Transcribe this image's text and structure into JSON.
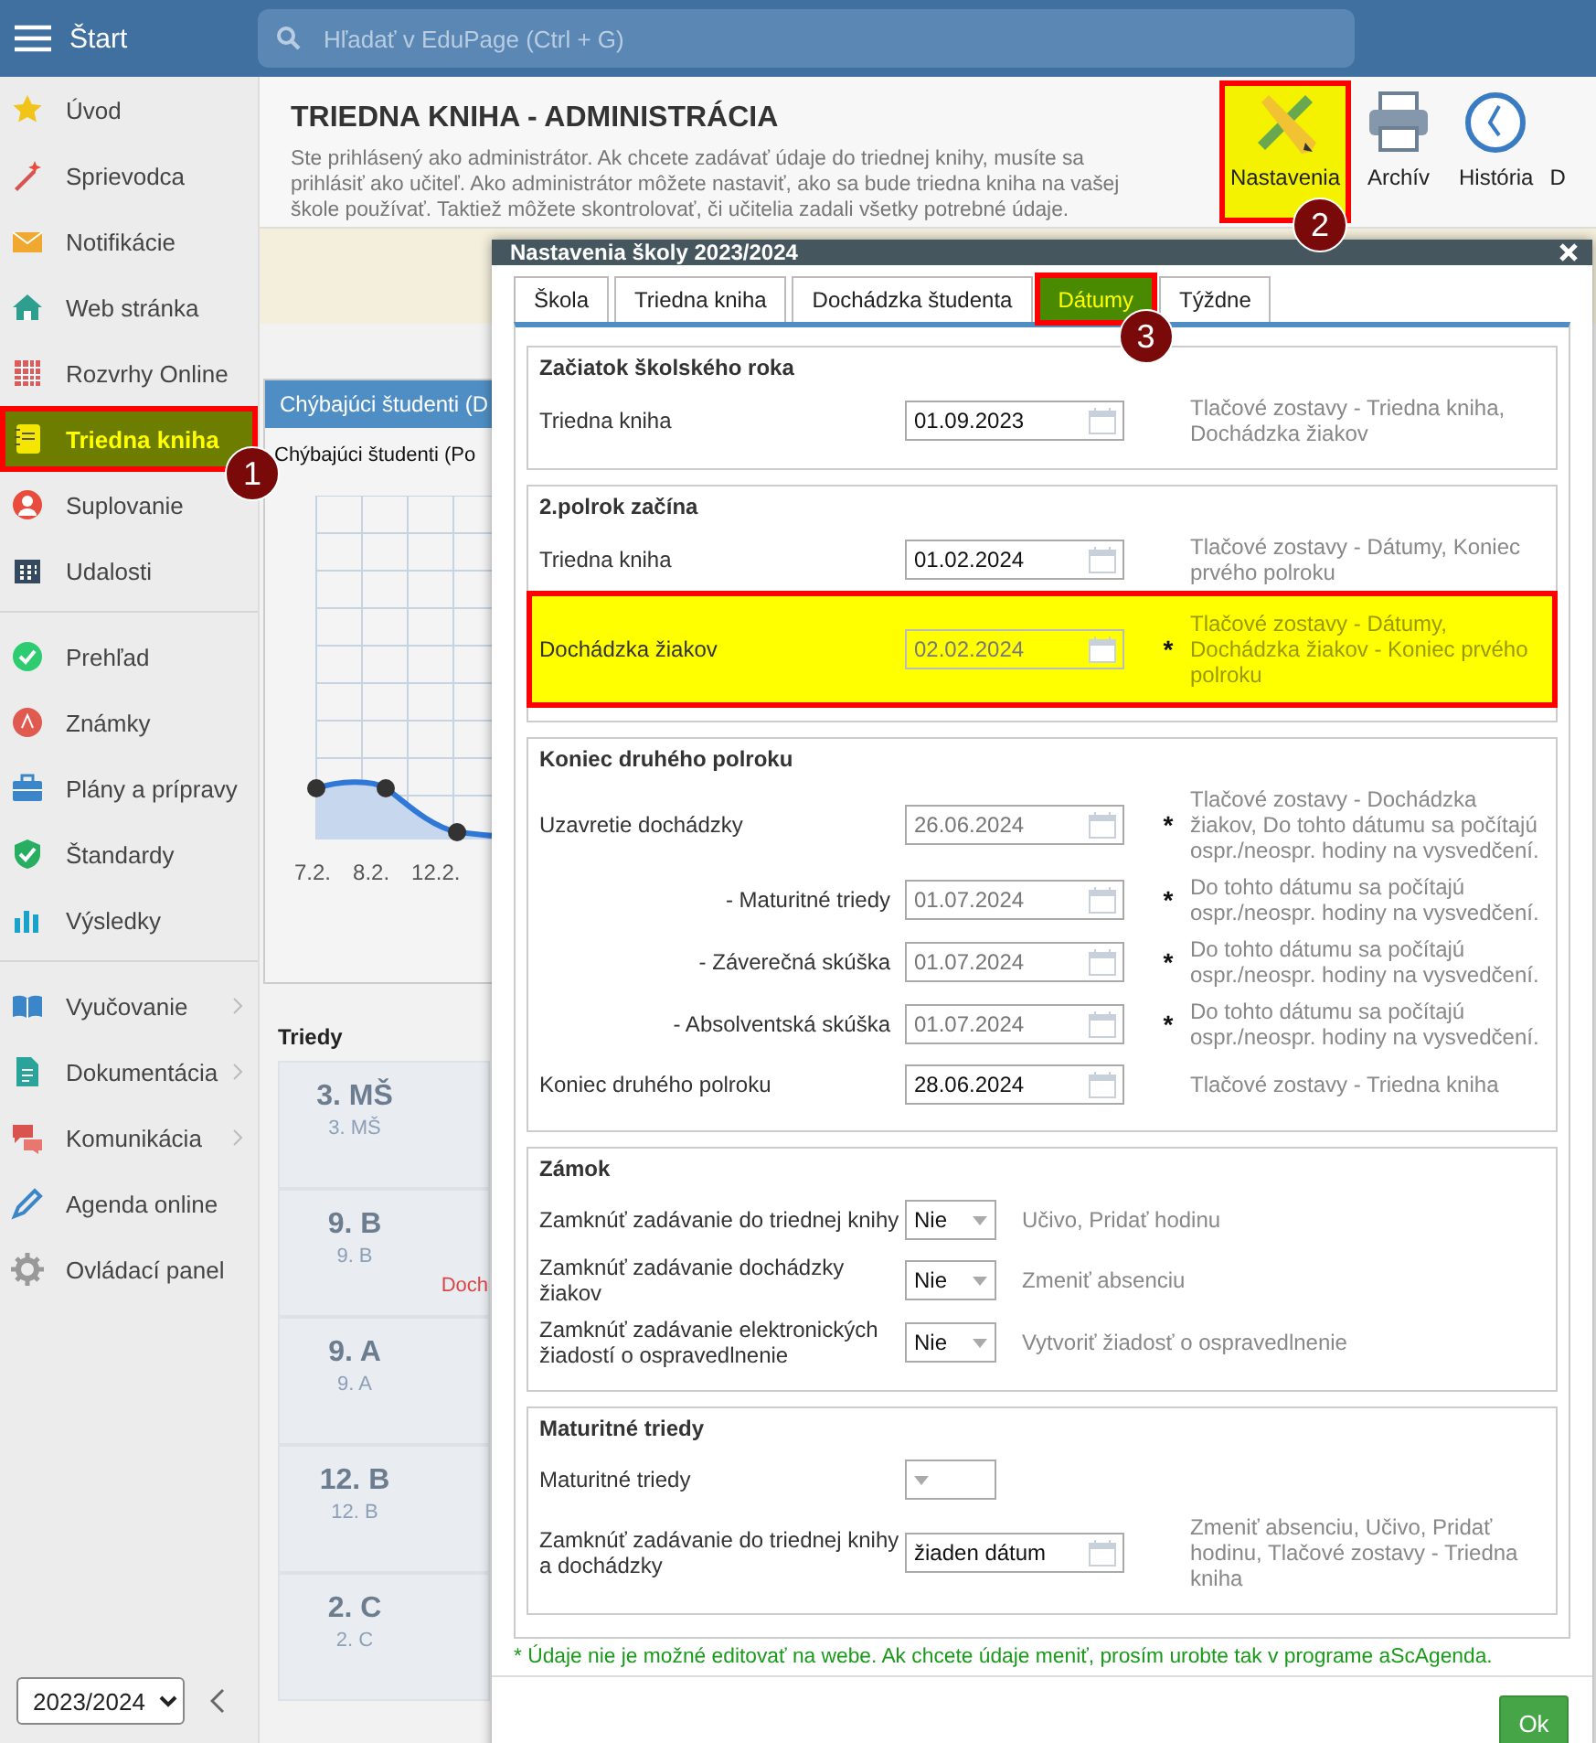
{
  "top_bar": {
    "menu_label": "Štart",
    "search": {
      "placeholder": "Hľadať v EduPage (Ctrl + G)"
    }
  },
  "sidebar": {
    "groups": [
      {
        "items": [
          {
            "label": "Úvod",
            "selected": false
          },
          {
            "label": "Sprievodca",
            "selected": false
          },
          {
            "label": "Notifikácie",
            "selected": false
          },
          {
            "label": "Web stránka",
            "selected": false
          },
          {
            "label": "Rozvrhy Online",
            "selected": false
          },
          {
            "label": "Triedna kniha",
            "selected": true,
            "step": "1"
          },
          {
            "label": "Suplovanie",
            "selected": false
          },
          {
            "label": "Udalosti",
            "selected": false
          }
        ]
      },
      {
        "items": [
          {
            "label": "Prehľad",
            "selected": false
          },
          {
            "label": "Známky",
            "selected": false
          },
          {
            "label": "Plány a prípravy",
            "selected": false
          },
          {
            "label": "Štandardy",
            "selected": false
          },
          {
            "label": "Výsledky",
            "selected": false
          }
        ]
      },
      {
        "items": [
          {
            "label": "Vyučovanie",
            "selected": false,
            "has_submenu": true
          },
          {
            "label": "Dokumentácia",
            "selected": false,
            "has_submenu": true
          },
          {
            "label": "Komunikácia",
            "selected": false,
            "has_submenu": true
          },
          {
            "label": "Agenda online",
            "selected": false,
            "has_submenu": false
          },
          {
            "label": "Ovládací panel",
            "selected": false,
            "has_submenu": false
          }
        ]
      }
    ],
    "year_select": "2023/2024"
  },
  "page_header": {
    "title": "TRIEDNA KNIHA - ADMINISTRÁCIA",
    "description": "Ste prihlásený ako administrátor. Ak chcete zadávať údaje do triednej knihy, musíte sa prihlásiť ako učiteľ. Ako administrátor môžete nastaviť, ako sa bude triedna kniha na vašej škole používať. Taktiež môžete skontrolovať, či učitelia zadali všetky potrebné údaje.",
    "toolbar": [
      {
        "label": "Nastavenia",
        "selected": true,
        "step": "2"
      },
      {
        "label": "Archív",
        "selected": false
      },
      {
        "label": "História",
        "selected": false
      },
      {
        "label": "D",
        "selected": false
      }
    ]
  },
  "absence_card": {
    "title": "Chýbajúci študenti (D",
    "subtitle": "Chýbajúci študenti (Po",
    "x_labels": [
      "7.2.",
      "8.2.",
      "12.2."
    ]
  },
  "classes": {
    "title": "Triedy",
    "items": [
      {
        "name": "3. MŠ",
        "short": "3. MŠ"
      },
      {
        "name": "9. B",
        "short": "9. B",
        "note": "Doch"
      },
      {
        "name": "9. A",
        "short": "9. A"
      },
      {
        "name": "12. B",
        "short": "12. B"
      },
      {
        "name": "2. C",
        "short": "2. C"
      }
    ]
  },
  "dialog": {
    "title": "Nastavenia školy 2023/2024",
    "tabs": [
      {
        "label": "Škola",
        "selected": false
      },
      {
        "label": "Triedna kniha",
        "selected": false
      },
      {
        "label": "Dochádzka študenta",
        "selected": false
      },
      {
        "label": "Dátumy",
        "selected": true,
        "step": "3"
      },
      {
        "label": "Týždne",
        "selected": false
      }
    ],
    "sections": [
      {
        "title": "Začiatok školského roka",
        "rows": [
          {
            "kind": "date",
            "label": "Triedna kniha",
            "value": "01.09.2023",
            "disabled": false,
            "note": "Tlačové zostavy - Triedna kniha, Dochádzka žiakov"
          }
        ]
      },
      {
        "title": "2.polrok začína",
        "rows": [
          {
            "kind": "date",
            "label": "Triedna kniha",
            "value": "01.02.2024",
            "disabled": false,
            "note": "Tlačové zostavy - Dátumy, Koniec prvého polroku"
          },
          {
            "kind": "date",
            "label": "Dochádzka žiakov",
            "value": "02.02.2024",
            "disabled": true,
            "mark": "*",
            "highlighted": true,
            "note": "Tlačové zostavy - Dátumy, Dochádzka žiakov - Koniec prvého polroku"
          }
        ]
      },
      {
        "title": "Koniec druhého polroku",
        "rows": [
          {
            "kind": "date",
            "label": "Uzavretie dochádzky",
            "value": "26.06.2024",
            "disabled": true,
            "mark": "*",
            "note": "Tlačové zostavy - Dochádzka žiakov, Do tohto dátumu sa počítajú ospr./neospr. hodiny na vysvedčení."
          },
          {
            "kind": "date",
            "label": "- Maturitné triedy",
            "sub": true,
            "value": "01.07.2024",
            "disabled": true,
            "mark": "*",
            "note": "Do tohto dátumu sa počítajú ospr./neospr. hodiny na vysvedčení."
          },
          {
            "kind": "date",
            "label": "- Záverečná skúška",
            "sub": true,
            "value": "01.07.2024",
            "disabled": true,
            "mark": "*",
            "note": "Do tohto dátumu sa počítajú ospr./neospr. hodiny na vysvedčení."
          },
          {
            "kind": "date",
            "label": "- Absolventská skúška",
            "sub": true,
            "value": "01.07.2024",
            "disabled": true,
            "mark": "*",
            "note": "Do tohto dátumu sa počítajú ospr./neospr. hodiny na vysvedčení."
          },
          {
            "kind": "date",
            "label": "Koniec druhého polroku",
            "value": "28.06.2024",
            "disabled": false,
            "note": "Tlačové zostavy - Triedna kniha"
          }
        ]
      },
      {
        "title": "Zámok",
        "rows": [
          {
            "kind": "select",
            "label": "Zamknúť zadávanie do triednej knihy",
            "value": "Nie",
            "note": "Učivo, Pridať hodinu"
          },
          {
            "kind": "select",
            "label": "Zamknúť zadávanie dochádzky žiakov",
            "value": "Nie",
            "note": "Zmeniť absenciu"
          },
          {
            "kind": "select",
            "label": "Zamknúť zadávanie elektronických žiadostí o ospravedlnenie",
            "value": "Nie",
            "note": "Vytvoriť žiadosť o ospravedlnenie"
          }
        ]
      },
      {
        "title": "Maturitné triedy",
        "rows": [
          {
            "kind": "select",
            "label": "Maturitné triedy"
          },
          {
            "kind": "date",
            "label": "Zamknúť zadávanie do triednej knihy a dochádzky",
            "value": "žiaden dátum",
            "disabled": false,
            "note": "Zmeniť absenciu, Učivo, Pridať hodinu, Tlačové zostavy - Triedna kniha"
          }
        ]
      }
    ],
    "footnote": "* Údaje nie je možné editovať na webe. Ak chcete údaje meniť, prosím urobte tak v programe aScAgenda.",
    "ok_button": "Ok"
  }
}
